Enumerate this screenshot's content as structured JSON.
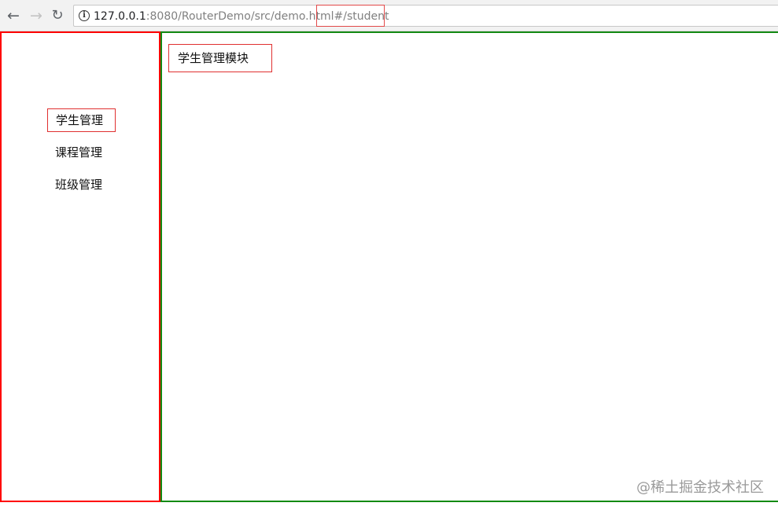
{
  "browser": {
    "url_host": "127.0.0.1",
    "url_path": ":8080/RouterDemo/src/demo.html#/student"
  },
  "sidebar": {
    "items": [
      {
        "label": "学生管理"
      },
      {
        "label": "课程管理"
      },
      {
        "label": "班级管理"
      }
    ]
  },
  "main": {
    "module_title": "学生管理模块"
  },
  "watermark": "@稀土掘金技术社区"
}
